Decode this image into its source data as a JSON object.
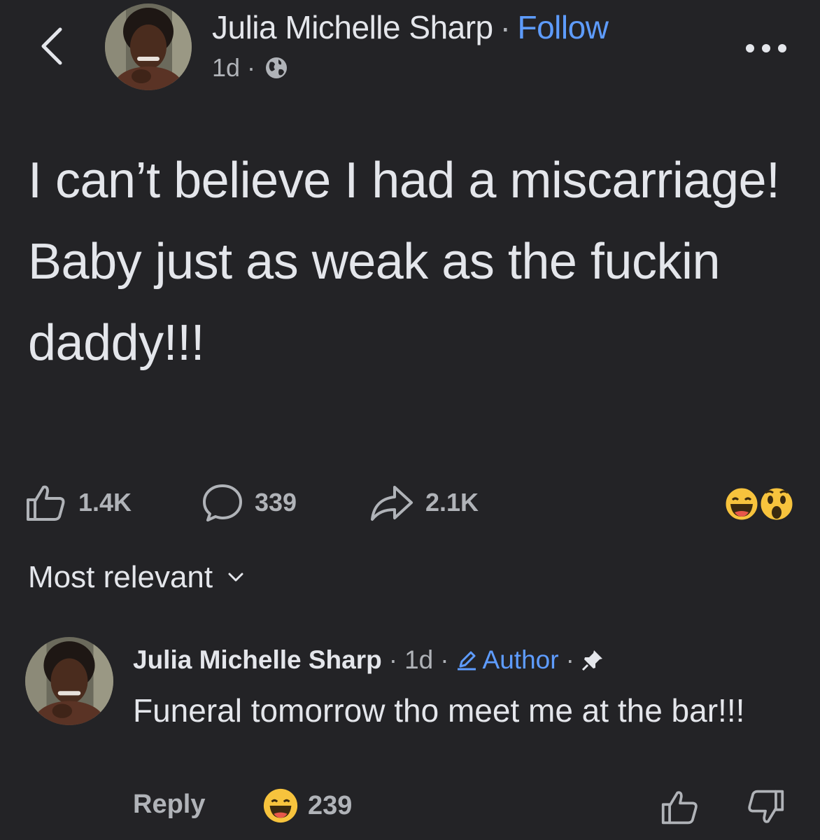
{
  "header": {
    "author": "Julia Michelle Sharp",
    "separator": "·",
    "follow": "Follow",
    "time": "1d",
    "meta_sep": "·",
    "privacy_icon": "globe-icon"
  },
  "post": {
    "text": "I can’t believe I had a miscarriage! Baby just as weak as the fuckin daddy!!!"
  },
  "actions": {
    "likes": "1.4K",
    "comments": "339",
    "shares": "2.1K",
    "reaction_icons": [
      "haha-reaction-icon",
      "wow-reaction-icon"
    ]
  },
  "sort": {
    "label": "Most relevant"
  },
  "comment": {
    "author": "Julia Michelle Sharp",
    "dot": "·",
    "time": "1d",
    "badge": "Author",
    "text": "Funeral tomorrow tho meet me at the bar!!!",
    "reply": "Reply",
    "reaction_count": "239"
  },
  "colors": {
    "background": "#232326",
    "text": "#e4e6eb",
    "muted": "#b0b3b8",
    "link": "#5e9cff",
    "reaction": "#f7c33d"
  }
}
